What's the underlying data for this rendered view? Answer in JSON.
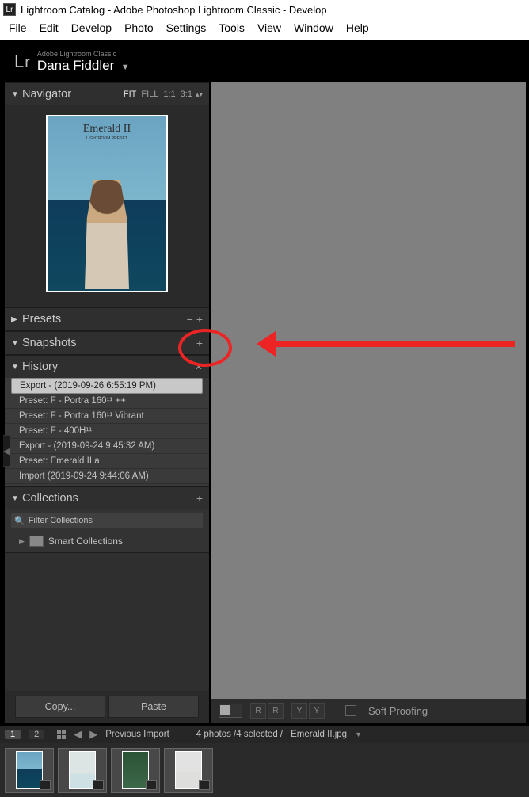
{
  "window_title": "Lightroom Catalog - Adobe Photoshop Lightroom Classic - Develop",
  "menubar": [
    "File",
    "Edit",
    "Develop",
    "Photo",
    "Settings",
    "Tools",
    "View",
    "Window",
    "Help"
  ],
  "identity": {
    "plan": "Adobe Lightroom Classic",
    "user": "Dana Fiddler"
  },
  "navigator": {
    "title": "Navigator",
    "zoom": {
      "fit": "FIT",
      "fill": "FILL",
      "one": "1:1",
      "three": "3:1"
    },
    "preview": {
      "t1": "Emerald II",
      "t2": "LIGHTROOM PRESET"
    }
  },
  "presets": {
    "title": "Presets"
  },
  "snapshots": {
    "title": "Snapshots"
  },
  "history": {
    "title": "History",
    "items": [
      "Export -  (2019-09-26 6:55:19 PM)",
      "Preset: F - Portra 160¹¹ ++",
      "Preset: F - Portra 160¹¹ Vibrant",
      "Preset: F - 400H¹¹",
      "Export -  (2019-09-24 9:45:32 AM)",
      "Preset: Emerald II a",
      "Import (2019-09-24 9:44:06 AM)"
    ]
  },
  "collections": {
    "title": "Collections",
    "filter_ph": "Filter Collections",
    "smart": "Smart Collections"
  },
  "buttons": {
    "copy": "Copy...",
    "paste": "Paste"
  },
  "soft_proofing": "Soft Proofing",
  "info": {
    "pages": [
      "1",
      "2"
    ],
    "source": "Previous Import",
    "count": "4 photos /4 selected /",
    "file": "Emerald II.jpg"
  }
}
